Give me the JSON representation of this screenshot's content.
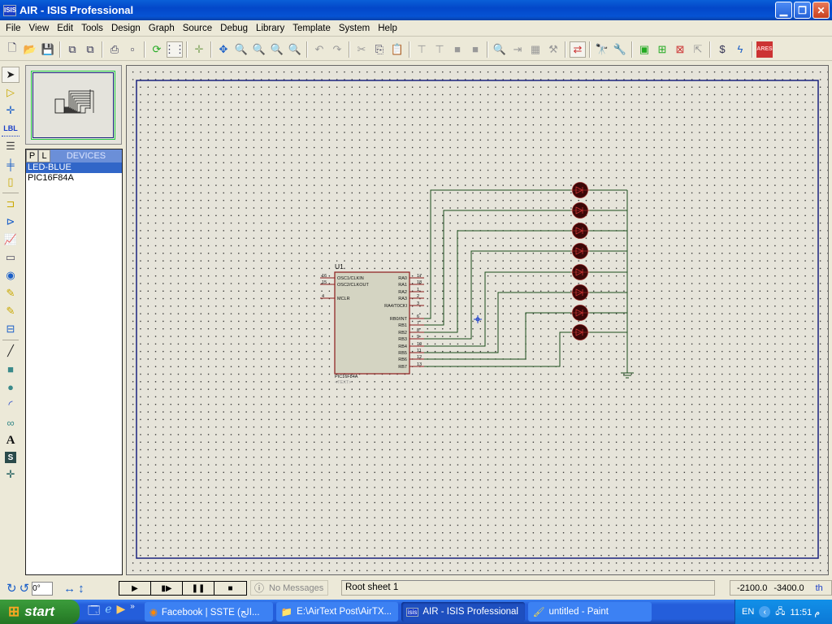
{
  "window": {
    "title": "AIR - ISIS Professional",
    "app_icon": "ISIS",
    "controls": [
      "minimize",
      "restore",
      "close"
    ]
  },
  "menu": [
    "File",
    "View",
    "Edit",
    "Tools",
    "Design",
    "Graph",
    "Source",
    "Debug",
    "Library",
    "Template",
    "System",
    "Help"
  ],
  "toolbar": {
    "icons": [
      "new-icon",
      "open-icon",
      "save-icon",
      "import-icon",
      "export-icon",
      "print-icon",
      "print-area-icon",
      "refresh-icon",
      "grid-icon",
      "origin-icon",
      "pan-icon",
      "zoom-in-icon",
      "zoom-out-icon",
      "zoom-all-icon",
      "zoom-area-icon",
      "undo-icon",
      "redo-icon",
      "cut-icon",
      "copy-icon",
      "paste-icon",
      "block-copy-icon",
      "block-move-icon",
      "block-rotate-icon",
      "block-delete-icon",
      "pick-device-icon",
      "make-device-icon",
      "package-icon",
      "decompose-icon",
      "wire-autorouter-icon",
      "search-icon",
      "property-tool-icon",
      "new-sheet-icon",
      "add-sheet-icon",
      "remove-sheet-icon",
      "goto-child-icon",
      "bill-of-materials-icon",
      "electrical-rules-icon",
      "ares-icon"
    ]
  },
  "left_tools": [
    "selection-mode",
    "component-mode",
    "junction-dot",
    "wire-label",
    "text-script",
    "buses",
    "subcircuit",
    "terminals",
    "device-pins",
    "graph-mode",
    "tape-recorder",
    "generator",
    "voltage-probe",
    "current-probe",
    "virtual-instruments",
    "line-2d",
    "box-2d",
    "circle-2d",
    "arc-2d",
    "path-2d",
    "text-2d",
    "symbols-2d",
    "markers-2d"
  ],
  "left_tool_labels": {
    "wire_label": "LBL"
  },
  "devices": {
    "tab_p": "P",
    "tab_l": "L",
    "title": "DEVICES",
    "items": [
      {
        "name": "LED-BLUE",
        "selected": true
      },
      {
        "name": "PIC16F84A",
        "selected": false
      }
    ]
  },
  "schematic": {
    "chip": {
      "ref": "U1",
      "part": "PIC16F84A",
      "text": "<TEXT>",
      "left_pins": [
        {
          "num": "16",
          "name": "OSC1/CLKIN"
        },
        {
          "num": "15",
          "name": "OSC2/CLKOUT"
        },
        {
          "num": "4",
          "name": "MCLR"
        }
      ],
      "right_pins": [
        {
          "num": "17",
          "name": "RA0"
        },
        {
          "num": "18",
          "name": "RA1"
        },
        {
          "num": "1",
          "name": "RA2"
        },
        {
          "num": "2",
          "name": "RA3"
        },
        {
          "num": "3",
          "name": "RA4/T0CKI"
        },
        {
          "num": "6",
          "name": "RB0/INT"
        },
        {
          "num": "7",
          "name": "RB1"
        },
        {
          "num": "8",
          "name": "RB2"
        },
        {
          "num": "9",
          "name": "RB3"
        },
        {
          "num": "10",
          "name": "RB4"
        },
        {
          "num": "11",
          "name": "RB5"
        },
        {
          "num": "12",
          "name": "RB6"
        },
        {
          "num": "13",
          "name": "RB7"
        }
      ]
    },
    "led_count": 8,
    "led_type": "LED-BLUE",
    "ground": true
  },
  "status": {
    "rotation": "0°",
    "sim_buttons": [
      "play",
      "step",
      "pause",
      "stop"
    ],
    "messages": "No Messages",
    "sheet": "Root sheet 1",
    "coord_x": "-2100.0",
    "coord_y": "-3400.0",
    "unit": "th"
  },
  "taskbar": {
    "start": "start",
    "tasks": [
      {
        "label": "Facebook | SSTE (الج...",
        "icon": "firefox-icon",
        "active": false
      },
      {
        "label": "E:\\AirText Post\\AirTX...",
        "icon": "folder-icon",
        "active": false
      },
      {
        "label": "AIR - ISIS Professional",
        "icon": "isis-icon",
        "active": true
      },
      {
        "label": "untitled - Paint",
        "icon": "paint-icon",
        "active": false
      }
    ],
    "lang": "EN",
    "time": "11:51 م"
  }
}
